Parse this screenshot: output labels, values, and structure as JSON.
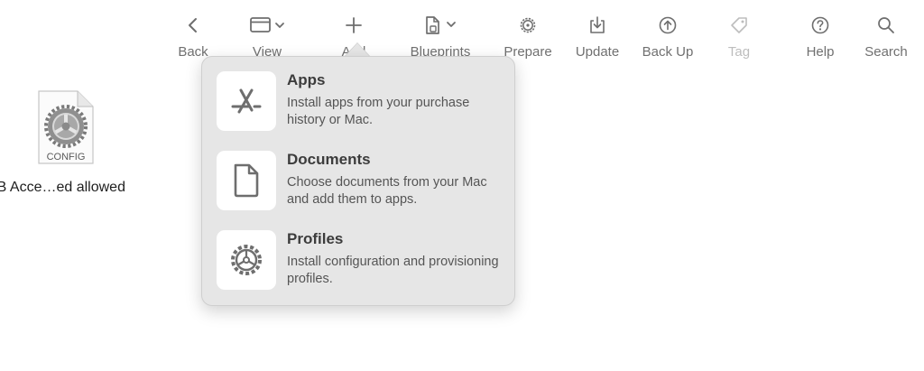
{
  "toolbar": {
    "back": "Back",
    "view": "View",
    "add": "Add",
    "blueprints": "Blueprints",
    "prepare": "Prepare",
    "update": "Update",
    "backup": "Back Up",
    "tag": "Tag",
    "help": "Help",
    "search": "Search"
  },
  "desktop": {
    "file_badge": "CONFIG",
    "file_label": "SB Acce…ed allowed"
  },
  "add_menu": {
    "items": [
      {
        "title": "Apps",
        "description": "Install apps from your purchase history or Mac."
      },
      {
        "title": "Documents",
        "description": "Choose documents from your Mac and add them to apps."
      },
      {
        "title": "Profiles",
        "description": "Install configuration and provisioning profiles."
      }
    ]
  },
  "colors": {
    "toolbar_icon": "#6e6e6e",
    "disabled": "#bdbdbd",
    "popover_bg": "#e6e6e6"
  }
}
